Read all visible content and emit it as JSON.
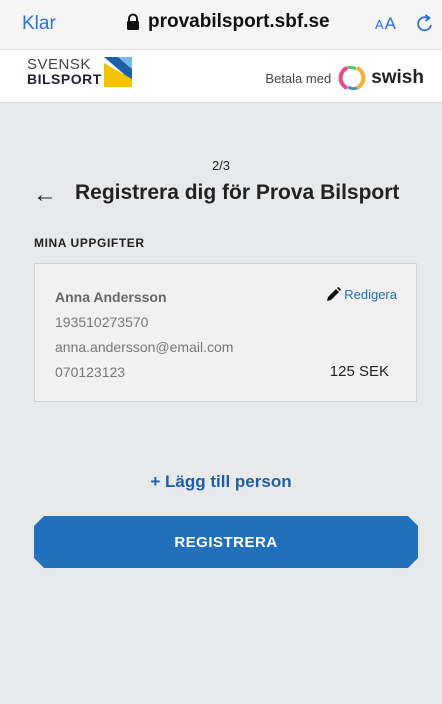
{
  "browser": {
    "done_label": "Klar",
    "url": "provabilsport.sbf.se",
    "text_size_label_small": "A",
    "text_size_label_large": "A",
    "icons": {
      "lock": "lock-icon",
      "reload": "reload-icon"
    }
  },
  "header": {
    "logo_line1": "SVENSK",
    "logo_line2": "BILSPORT",
    "pay_label": "Betala med",
    "swish_label": "swish",
    "brand_colors": {
      "blue": "#1f5fa3",
      "yellow": "#f4c300",
      "light_blue": "#7ab8e6"
    }
  },
  "page": {
    "step": "2/3",
    "title": "Registrera dig för Prova Bilsport",
    "section_label": "MINA UPPGIFTER",
    "add_person_label": "+ Lägg till person",
    "register_label": "REGISTRERA"
  },
  "person": {
    "name": "Anna Andersson",
    "personal_number": "193510273570",
    "email": "anna.andersson@email.com",
    "phone": "070123123",
    "price": "125 SEK",
    "edit_label": "Redigera"
  },
  "colors": {
    "accent": "#2070bc",
    "link": "#1f6bb8",
    "background": "#e8e9eb"
  }
}
